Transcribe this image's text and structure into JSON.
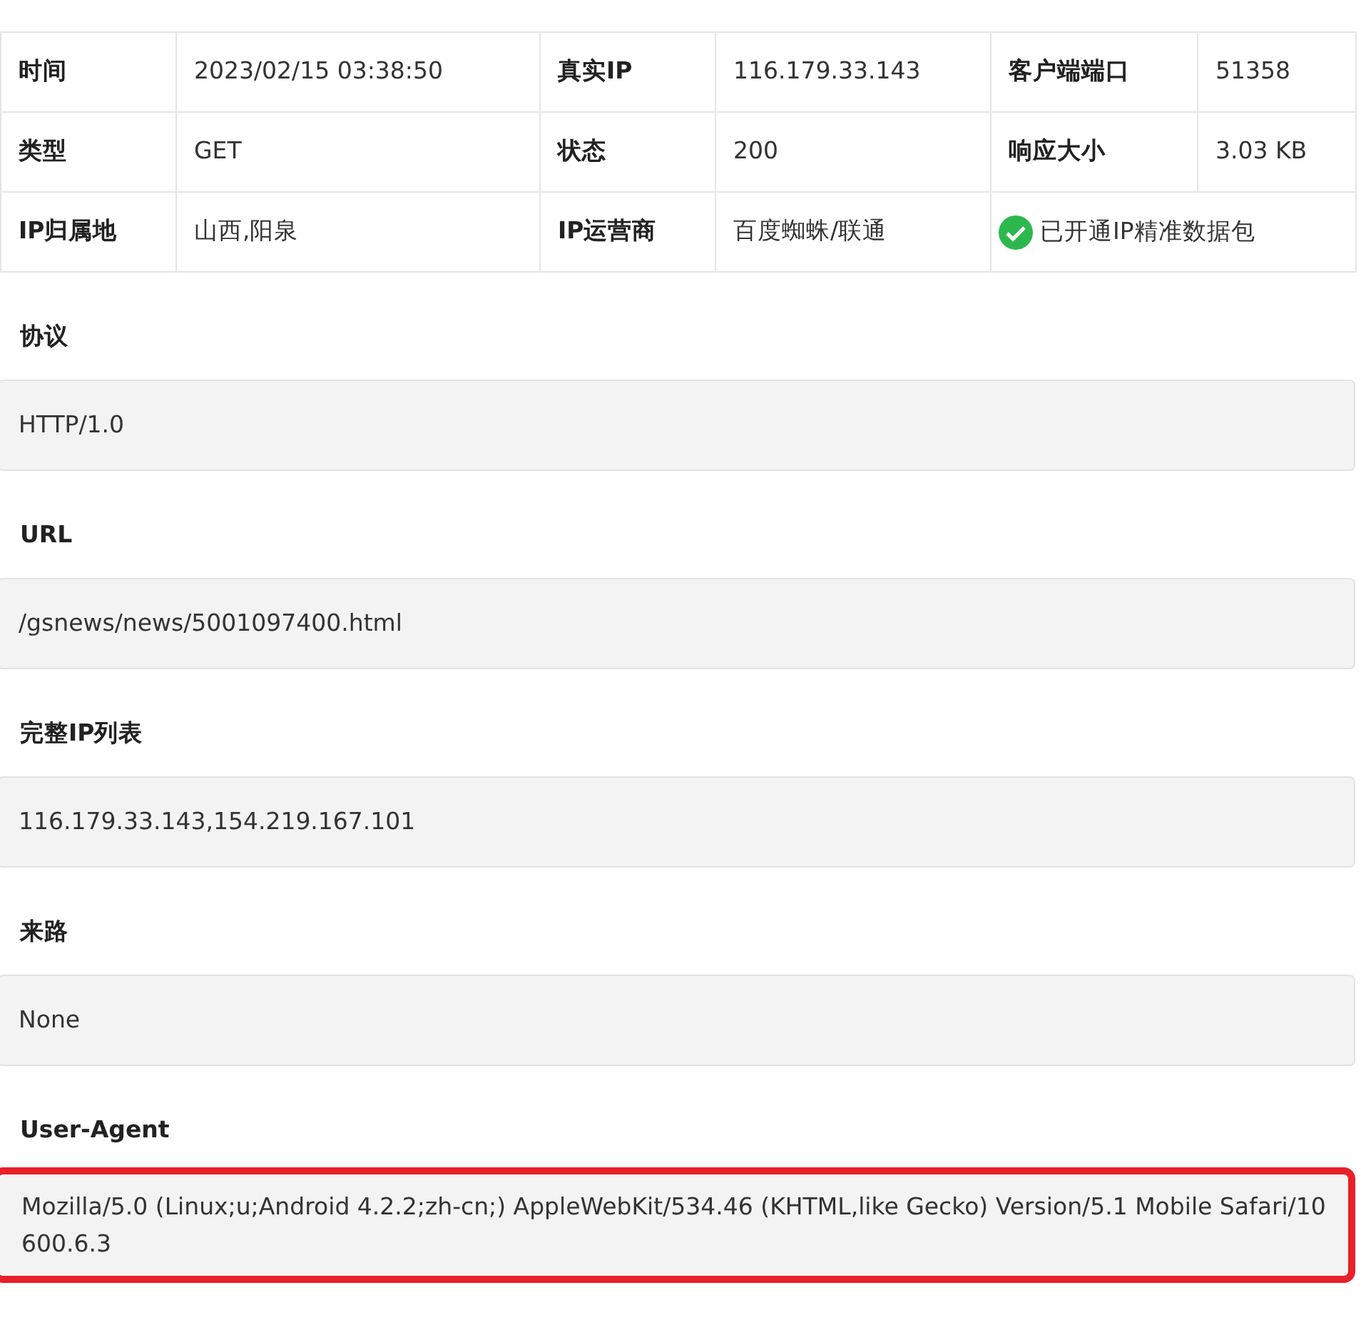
{
  "info_table": {
    "rows": [
      [
        {
          "label": "时间",
          "value": "2023/02/15 03:38:50"
        },
        {
          "label": "真实IP",
          "value": "116.179.33.143"
        },
        {
          "label": "客户端端口",
          "value": "51358"
        }
      ],
      [
        {
          "label": "类型",
          "value": "GET"
        },
        {
          "label": "状态",
          "value": "200"
        },
        {
          "label": "响应大小",
          "value": "3.03 KB"
        }
      ],
      [
        {
          "label": "IP归属地",
          "value": "山西,阳泉"
        },
        {
          "label": "IP运营商",
          "value": "百度蜘蛛/联通"
        },
        {
          "value": "已开通IP精准数据包",
          "verified": true
        }
      ]
    ]
  },
  "fields": [
    {
      "label": "协议",
      "value": "HTTP/1.0",
      "highlighted": false
    },
    {
      "label": "URL",
      "value": "/gsnews/news/5001097400.html",
      "highlighted": false
    },
    {
      "label": "完整IP列表",
      "value": "116.179.33.143,154.219.167.101",
      "highlighted": false
    },
    {
      "label": "来路",
      "value": "None",
      "highlighted": false
    },
    {
      "label": "User-Agent",
      "value": "Mozilla/5.0 (Linux;u;Android 4.2.2;zh-cn;) AppleWebKit/534.46 (KHTML,like Gecko) Version/5.1 Mobile Safari/10600.6.3",
      "highlighted": true
    }
  ]
}
